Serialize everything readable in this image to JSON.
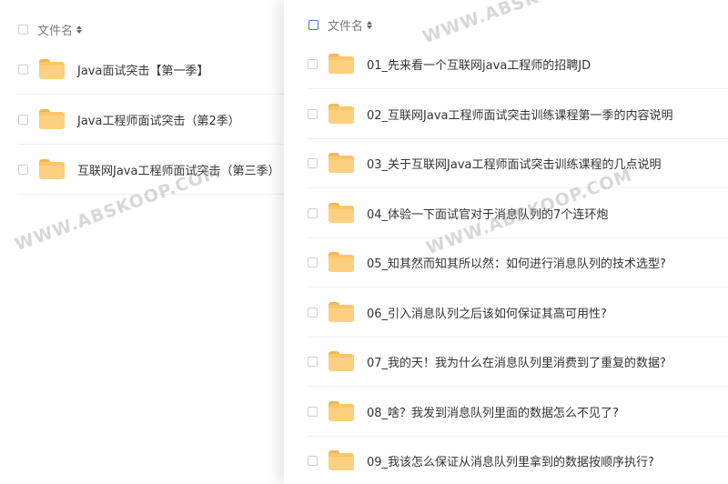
{
  "left_list": {
    "header": "文件名",
    "items": [
      {
        "name": "Java面试突击【第一季】"
      },
      {
        "name": "Java工程师面试突击（第2季）"
      },
      {
        "name": "互联网Java工程师面试突击（第三季）"
      }
    ]
  },
  "right_list": {
    "header": "文件名",
    "items": [
      {
        "name": "01_先来看一个互联网java工程师的招聘JD"
      },
      {
        "name": "02_互联网Java工程师面试突击训练课程第一季的内容说明"
      },
      {
        "name": "03_关于互联网Java工程师面试突击训练课程的几点说明"
      },
      {
        "name": "04_体验一下面试官对于消息队列的7个连环炮"
      },
      {
        "name": "05_知其然而知其所以然：如何进行消息队列的技术选型?"
      },
      {
        "name": "06_引入消息队列之后该如何保证其高可用性?"
      },
      {
        "name": "07_我的天！我为什么在消息队列里消费到了重复的数据?"
      },
      {
        "name": "08_啥？我发到消息队列里面的数据怎么不见了?"
      },
      {
        "name": "09_我该怎么保证从消息队列里拿到的数据按顺序执行?"
      }
    ]
  },
  "watermark": "WWW.ABSKOOP.COM",
  "colors": {
    "folder": "#fbc66a",
    "accent_checkbox": "#4a6fd6"
  }
}
